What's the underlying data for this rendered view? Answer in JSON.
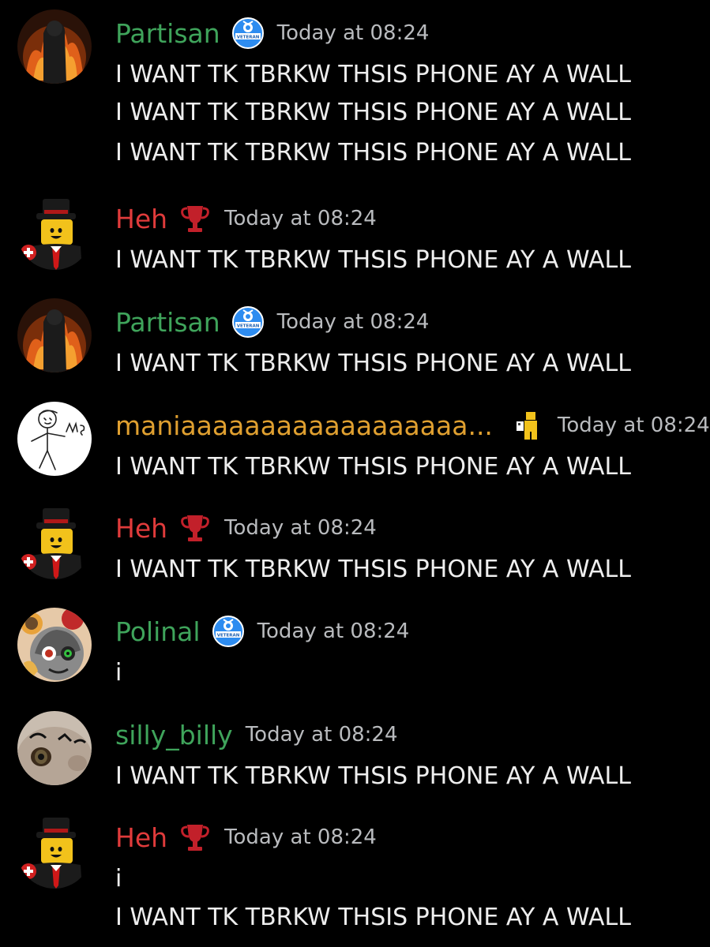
{
  "colors": {
    "background": "#000000",
    "partisan": "#3fa45b",
    "heh": "#e03b3b",
    "mania": "#e0a030",
    "polinal": "#3fa45b",
    "silly_billy": "#3fa45b",
    "timestamp": "#b9bbbe",
    "text": "#eeeeee"
  },
  "messages": [
    {
      "username": "Partisan",
      "badge": "veteran-badge-icon",
      "badge_text": "VETERAN",
      "timestamp": "Today at 08:24",
      "lines": [
        "I WANT TK TBRKW THSIS PHONE AY A WALL",
        "I WANT TK TBRKW THSIS PHONE AY A WALL",
        "I WANT TK TBRKW THSIS PHONE AY A WALL"
      ]
    },
    {
      "username": "Heh",
      "badge": "trophy-icon",
      "timestamp": "Today at 08:24",
      "lines": [
        "I WANT TK TBRKW THSIS PHONE AY A WALL"
      ]
    },
    {
      "username": "Partisan",
      "badge": "veteran-badge-icon",
      "badge_text": "VETERAN",
      "timestamp": "Today at 08:24",
      "lines": [
        "I WANT TK TBRKW THSIS PHONE AY A WALL"
      ]
    },
    {
      "username": "maniaaaaaaaaaaaaaaaaaa...",
      "badge": "roblox-figure-icon",
      "timestamp": "Today at 08:24",
      "lines": [
        "I WANT TK TBRKW THSIS PHONE AY A WALL"
      ]
    },
    {
      "username": "Heh",
      "badge": "trophy-icon",
      "timestamp": "Today at 08:24",
      "lines": [
        "I WANT TK TBRKW THSIS PHONE AY A WALL"
      ]
    },
    {
      "username": "Polinal",
      "badge": "veteran-badge-icon",
      "badge_text": "VETERAN",
      "timestamp": "Today at 08:24",
      "lines": [
        "i"
      ]
    },
    {
      "username": "silly_billy",
      "timestamp": "Today at 08:24",
      "lines": [
        "I WANT TK TBRKW THSIS PHONE AY A WALL"
      ]
    },
    {
      "username": "Heh",
      "badge": "trophy-icon",
      "timestamp": "Today at 08:24",
      "lines": [
        "i",
        "I WANT TK TBRKW THSIS PHONE AY A WALL"
      ]
    }
  ]
}
